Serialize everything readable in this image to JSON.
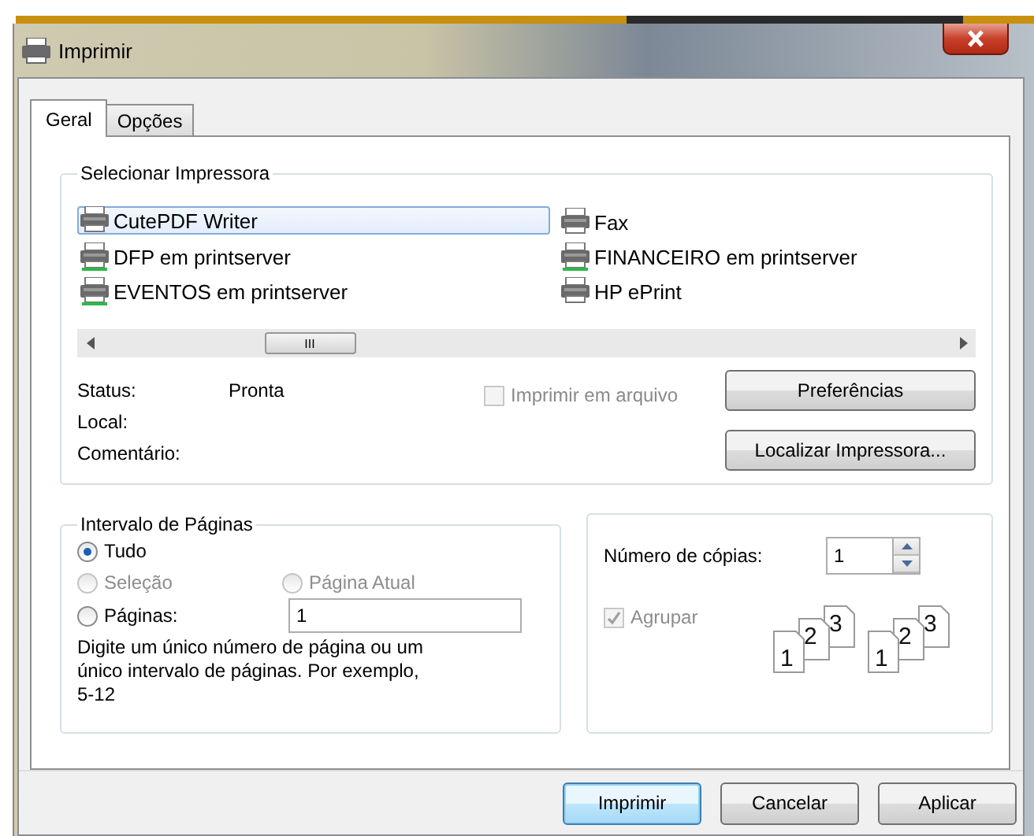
{
  "window": {
    "title": "Imprimir"
  },
  "tabs": [
    {
      "label": "Geral",
      "selected": true
    },
    {
      "label": "Opções",
      "selected": false
    }
  ],
  "printer_group": {
    "title": "Selecionar Impressora",
    "printers": [
      {
        "name": "CutePDF Writer",
        "selected": true,
        "network": false
      },
      {
        "name": "Fax",
        "selected": false,
        "network": false
      },
      {
        "name": "DFP em printserver",
        "selected": false,
        "network": true
      },
      {
        "name": "FINANCEIRO em printserver",
        "selected": false,
        "network": true
      },
      {
        "name": "EVENTOS em printserver",
        "selected": false,
        "network": true
      },
      {
        "name": "HP ePrint",
        "selected": false,
        "network": false
      }
    ],
    "scroll_grip": "III",
    "details": [
      {
        "label": "Status:",
        "value": "Pronta"
      },
      {
        "label": "Local:"
      },
      {
        "label": "Comentário:"
      }
    ],
    "print_to_file": {
      "label": "Imprimir em arquivo",
      "checked": false,
      "disabled": true
    },
    "buttons": [
      "Preferências",
      "Localizar Impressora..."
    ]
  },
  "page_range": {
    "title": "Intervalo de Páginas",
    "options": [
      {
        "label": "Tudo",
        "selected": true,
        "disabled": false
      },
      {
        "label": "Seleção",
        "selected": false,
        "disabled": true
      },
      {
        "label": "Página Atual",
        "selected": false,
        "disabled": true
      },
      {
        "label": "Páginas:",
        "selected": false,
        "disabled": false
      }
    ],
    "pages_value": "1",
    "hint": "Digite um único número de página ou um único intervalo de páginas. Por exemplo, 5-12"
  },
  "copies": {
    "label": "Número de cópias:",
    "value": "1",
    "collate": {
      "label": "Agrupar",
      "checked": true,
      "disabled": true
    },
    "collate_illustration": [
      [
        "1",
        "2",
        "3"
      ],
      [
        "1",
        "2",
        "3"
      ]
    ]
  },
  "buttons": [
    {
      "label": "Imprimir",
      "default": true
    },
    {
      "label": "Cancelar",
      "default": false
    },
    {
      "label": "Aplicar",
      "default": false
    }
  ]
}
